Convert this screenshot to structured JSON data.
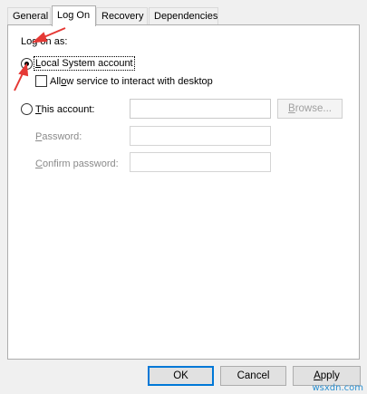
{
  "tabs": [
    {
      "label": "General"
    },
    {
      "label": "Log On"
    },
    {
      "label": "Recovery"
    },
    {
      "label": "Dependencies"
    }
  ],
  "logon": {
    "section_label": "Log on as:",
    "local_system": {
      "label_mnemonic": "L",
      "label_rest": "ocal System account",
      "selected": true
    },
    "interact_desktop": {
      "label_pre": "All",
      "label_mnemonic": "o",
      "label_rest": "w service to interact with desktop",
      "checked": false
    },
    "this_account": {
      "label_mnemonic": "T",
      "label_rest": "his account:",
      "selected": false,
      "value": ""
    },
    "browse_button": {
      "label_mnemonic": "B",
      "label_rest": "rowse..."
    },
    "password": {
      "label_mnemonic": "P",
      "label_rest": "assword:",
      "value": ""
    },
    "confirm_password": {
      "label_mnemonic": "C",
      "label_rest": "onfirm password:",
      "value": ""
    }
  },
  "buttons": {
    "ok": "OK",
    "cancel": "Cancel",
    "apply_mnemonic": "A",
    "apply_rest": "pply"
  },
  "watermark": "wsxdn.com",
  "colors": {
    "annotation_arrow": "#e53935",
    "default_button_border": "#0078d7"
  }
}
